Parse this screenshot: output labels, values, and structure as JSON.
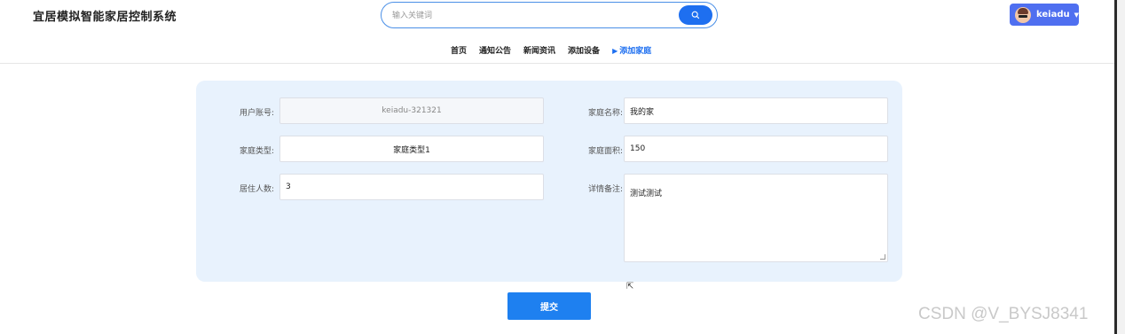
{
  "header": {
    "site_title": "宜居模拟智能家居控制系统",
    "search_placeholder": "输入关键词",
    "user_name": "keiadu"
  },
  "nav": {
    "items": [
      "首页",
      "通知公告",
      "新闻资讯",
      "添加设备"
    ],
    "active": "添加家庭"
  },
  "form": {
    "account_label": "用户账号:",
    "account_value": "keiadu-321321",
    "family_name_label": "家庭名称:",
    "family_name_value": "我的家",
    "family_type_label": "家庭类型:",
    "family_type_value": "家庭类型1",
    "area_label": "家庭面积:",
    "area_value": "150",
    "residents_label": "居住人数:",
    "residents_value": "3",
    "notes_label": "详情备注:",
    "notes_value": "测试测试"
  },
  "submit_label": "提交",
  "watermark": "CSDN @V_BYSJ8341",
  "colors": {
    "accent": "#1e6ff0",
    "panel_bg": "#e8f2fd",
    "user_btn": "#4f6ff0"
  }
}
